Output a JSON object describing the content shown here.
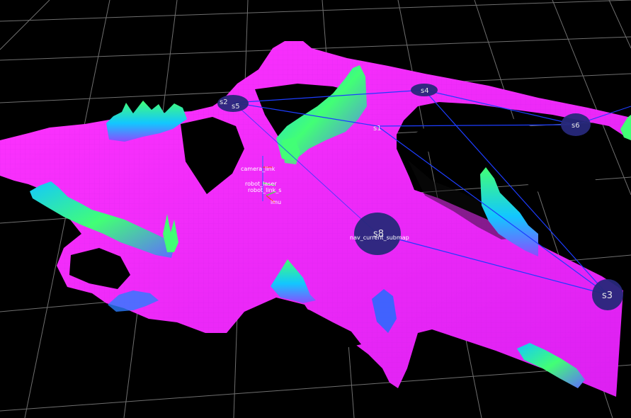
{
  "scene": {
    "background": "#000000",
    "grid_color": "#6f6f6f",
    "map_color": "#ff33ff",
    "map_shadow_color": "#c920f2",
    "obstacle_colors": [
      "#12c7ff",
      "#42ff75",
      "#8a4dff"
    ],
    "edge_color": "#1d3dff",
    "waypoint_fill": "#27287a",
    "waypoint_text": "#e6e6e6"
  },
  "waypoints": [
    {
      "label": "s2"
    },
    {
      "label": "s5"
    },
    {
      "label": "s4"
    },
    {
      "label": "s6"
    },
    {
      "label": "s1"
    },
    {
      "label": "s8"
    },
    {
      "label": "s3"
    }
  ],
  "frames": {
    "camera_label": "camera_link",
    "laser_label": "robot_laser",
    "base_label": "robot_link_s",
    "imu_label": "imu"
  },
  "navigation": {
    "current_submap_label": "nav_current_submap"
  }
}
